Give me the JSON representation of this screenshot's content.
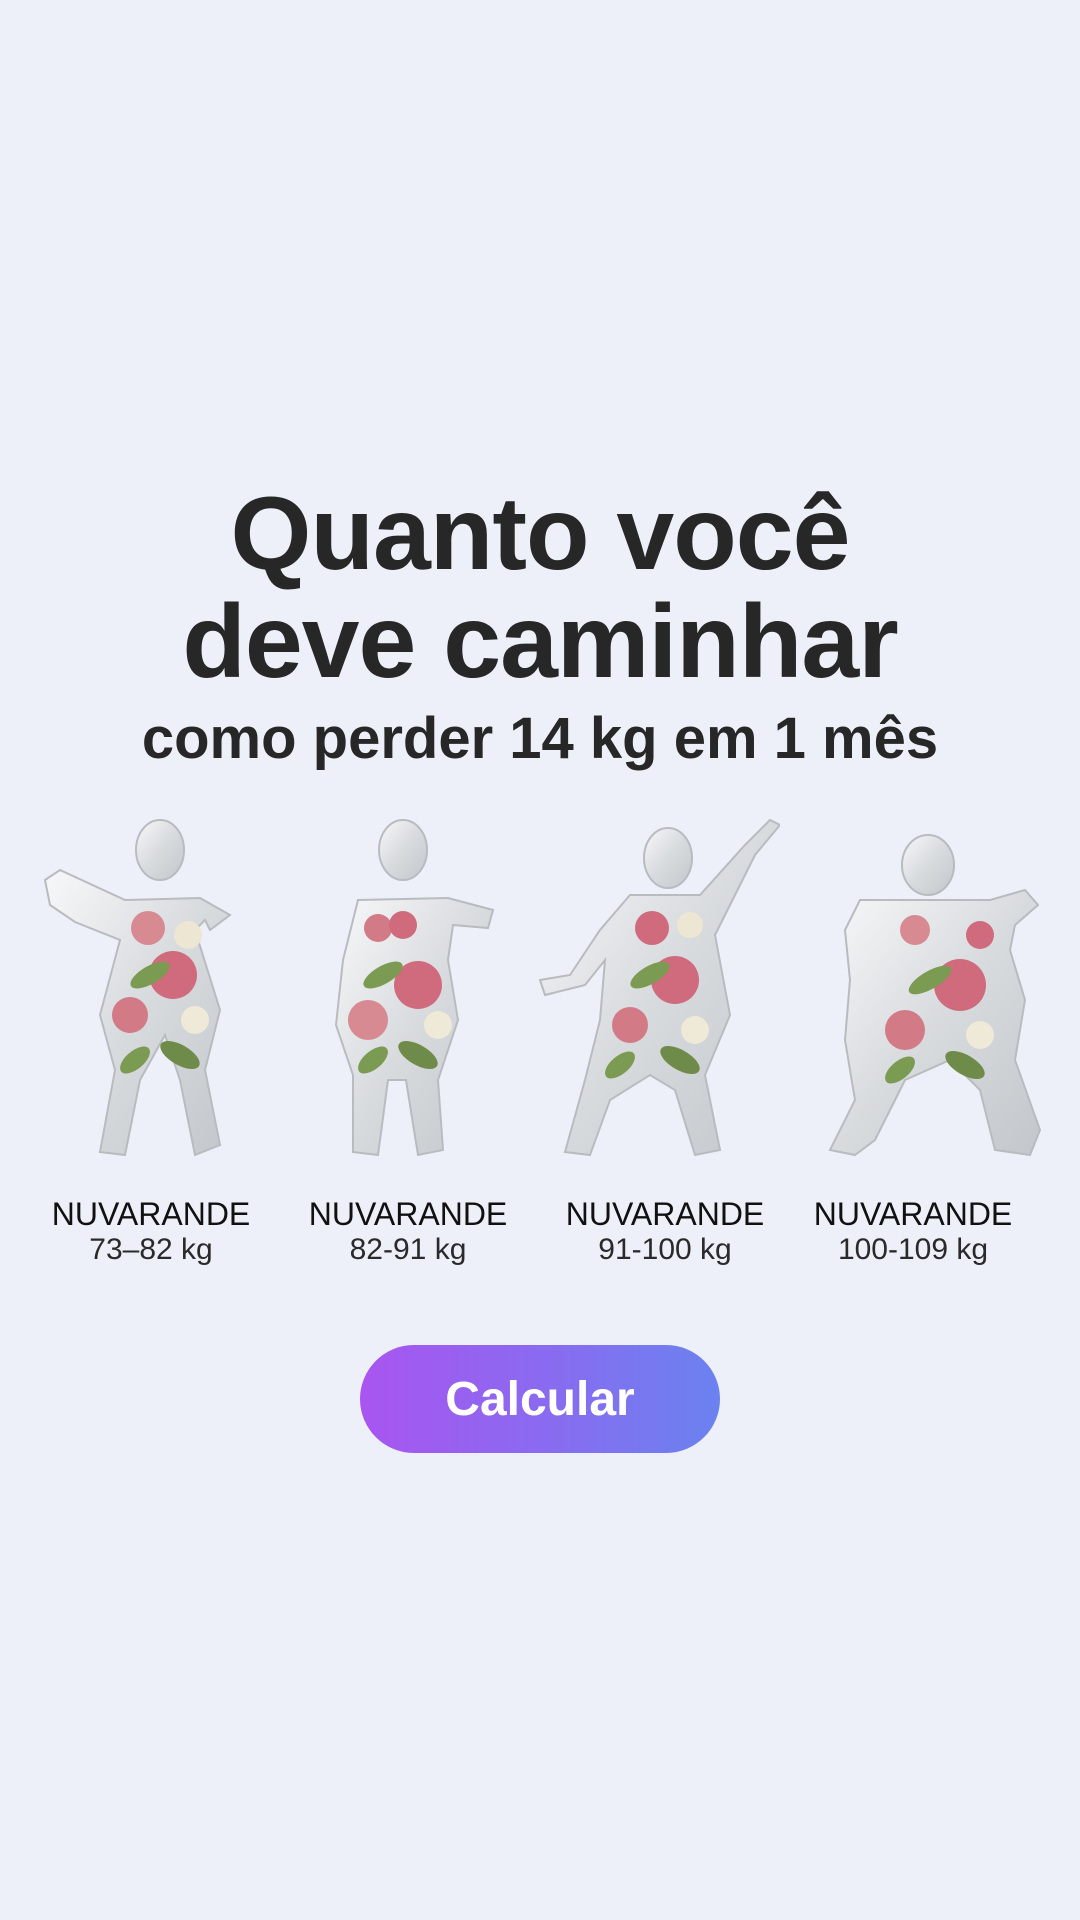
{
  "headline": {
    "title_line1": "Quanto você",
    "title_line2": "deve caminhar",
    "subtitle": "como perder 14 kg em 1 mês"
  },
  "body_types": [
    {
      "name": "NUVARANDE",
      "range": "73–82 kg"
    },
    {
      "name": "NUVARANDE",
      "range": "82-91 kg"
    },
    {
      "name": "NUVARANDE",
      "range": "91-100 kg"
    },
    {
      "name": "NUVARANDE",
      "range": "100-109 kg"
    }
  ],
  "cta": {
    "label": "Calcular"
  },
  "colors": {
    "background": "#edf0f8",
    "text": "#272727",
    "button_gradient_start": "#a955f0",
    "button_gradient_end": "#6b82ef",
    "glass": "#e9ecef",
    "rose": "#c9566e",
    "leaf": "#6f8b49"
  }
}
